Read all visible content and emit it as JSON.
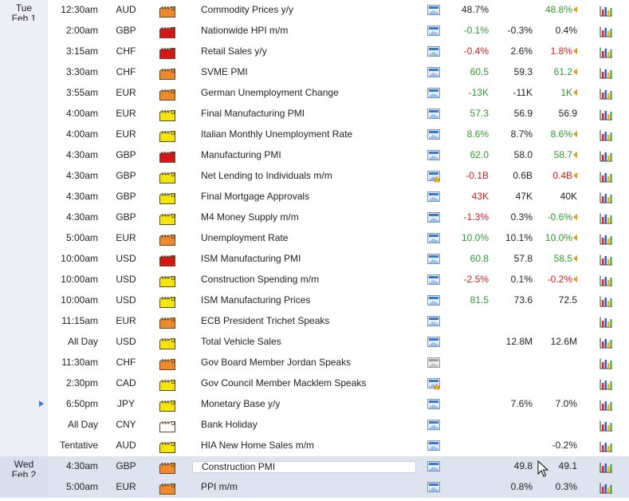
{
  "days": [
    {
      "line1": "Tue",
      "line2": "Feb 1"
    },
    {
      "line1": "Wed",
      "line2": "Feb 2"
    }
  ],
  "impact_colors": {
    "high": "#d81616",
    "medium": "#f0882c",
    "low": "#f5e60a",
    "none": "#ffffff"
  },
  "events": [
    {
      "day": 0,
      "time": "12:30am",
      "currency": "AUD",
      "impact": "medium",
      "name": "Commodity Prices y/y",
      "detail_icon": "detail-icon",
      "actual": "48.7%",
      "actual_class": "neutral",
      "forecast": "",
      "previous": "48.8%",
      "previous_class": "pos",
      "revised": true
    },
    {
      "day": 0,
      "time": "2:00am",
      "currency": "GBP",
      "impact": "high",
      "name": "Nationwide HPI m/m",
      "detail_icon": "detail-icon",
      "actual": "-0.1%",
      "actual_class": "pos",
      "forecast": "-0.3%",
      "previous": "0.4%",
      "previous_class": "neutral",
      "revised": false
    },
    {
      "day": 0,
      "time": "3:15am",
      "currency": "CHF",
      "impact": "high",
      "name": "Retail Sales y/y",
      "detail_icon": "detail-icon",
      "actual": "-0.4%",
      "actual_class": "neg",
      "forecast": "2.6%",
      "previous": "1.8%",
      "previous_class": "neg",
      "revised": true
    },
    {
      "day": 0,
      "time": "3:30am",
      "currency": "CHF",
      "impact": "medium",
      "name": "SVME PMI",
      "detail_icon": "detail-icon",
      "actual": "60.5",
      "actual_class": "pos",
      "forecast": "59.3",
      "previous": "61.2",
      "previous_class": "pos",
      "revised": true
    },
    {
      "day": 0,
      "time": "3:55am",
      "currency": "EUR",
      "impact": "medium",
      "name": "German Unemployment Change",
      "detail_icon": "detail-icon",
      "actual": "-13K",
      "actual_class": "pos",
      "forecast": "-11K",
      "previous": "1K",
      "previous_class": "pos",
      "revised": true
    },
    {
      "day": 0,
      "time": "4:00am",
      "currency": "EUR",
      "impact": "low",
      "name": "Final Manufacturing PMI",
      "detail_icon": "detail-icon",
      "actual": "57.3",
      "actual_class": "pos",
      "forecast": "56.9",
      "previous": "56.9",
      "previous_class": "neutral",
      "revised": false
    },
    {
      "day": 0,
      "time": "4:00am",
      "currency": "EUR",
      "impact": "low",
      "name": "Italian Monthly Unemployment Rate",
      "detail_icon": "detail-icon",
      "actual": "8.6%",
      "actual_class": "pos",
      "forecast": "8.7%",
      "previous": "8.6%",
      "previous_class": "pos",
      "revised": true
    },
    {
      "day": 0,
      "time": "4:30am",
      "currency": "GBP",
      "impact": "high",
      "name": "Manufacturing PMI",
      "detail_icon": "detail-icon",
      "actual": "62.0",
      "actual_class": "pos",
      "forecast": "58.0",
      "previous": "58.7",
      "previous_class": "pos",
      "revised": true
    },
    {
      "day": 0,
      "time": "4:30am",
      "currency": "GBP",
      "impact": "low",
      "name": "Net Lending to Individuals m/m",
      "detail_icon": "detail-star-icon",
      "actual": "-0.1B",
      "actual_class": "neg",
      "forecast": "0.6B",
      "previous": "0.4B",
      "previous_class": "neg",
      "revised": true
    },
    {
      "day": 0,
      "time": "4:30am",
      "currency": "GBP",
      "impact": "low",
      "name": "Final Mortgage Approvals",
      "detail_icon": "detail-icon",
      "actual": "43K",
      "actual_class": "neg",
      "forecast": "47K",
      "previous": "40K",
      "previous_class": "neutral",
      "revised": false
    },
    {
      "day": 0,
      "time": "4:30am",
      "currency": "GBP",
      "impact": "low",
      "name": "M4 Money Supply m/m",
      "detail_icon": "detail-icon",
      "actual": "-1.3%",
      "actual_class": "neg",
      "forecast": "0.3%",
      "previous": "-0.6%",
      "previous_class": "pos",
      "revised": true
    },
    {
      "day": 0,
      "time": "5:00am",
      "currency": "EUR",
      "impact": "medium",
      "name": "Unemployment Rate",
      "detail_icon": "detail-icon",
      "actual": "10.0%",
      "actual_class": "pos",
      "forecast": "10.1%",
      "previous": "10.0%",
      "previous_class": "pos",
      "revised": true
    },
    {
      "day": 0,
      "time": "10:00am",
      "currency": "USD",
      "impact": "high",
      "name": "ISM Manufacturing PMI",
      "detail_icon": "detail-icon",
      "actual": "60.8",
      "actual_class": "pos",
      "forecast": "57.8",
      "previous": "58.5",
      "previous_class": "pos",
      "revised": true
    },
    {
      "day": 0,
      "time": "10:00am",
      "currency": "USD",
      "impact": "low",
      "name": "Construction Spending m/m",
      "detail_icon": "detail-icon",
      "actual": "-2.5%",
      "actual_class": "neg",
      "forecast": "0.1%",
      "previous": "-0.2%",
      "previous_class": "neg",
      "revised": true
    },
    {
      "day": 0,
      "time": "10:00am",
      "currency": "USD",
      "impact": "low",
      "name": "ISM Manufacturing Prices",
      "detail_icon": "detail-icon",
      "actual": "81.5",
      "actual_class": "pos",
      "forecast": "73.6",
      "previous": "72.5",
      "previous_class": "neutral",
      "revised": false
    },
    {
      "day": 0,
      "time": "11:15am",
      "currency": "EUR",
      "impact": "medium",
      "name": "ECB President Trichet Speaks",
      "detail_icon": "detail-icon",
      "actual": "",
      "actual_class": "neutral",
      "forecast": "",
      "previous": "",
      "previous_class": "neutral",
      "revised": false
    },
    {
      "day": 0,
      "time": "All Day",
      "currency": "USD",
      "impact": "low",
      "name": "Total Vehicle Sales",
      "detail_icon": "detail-icon",
      "actual": "",
      "actual_class": "neutral",
      "forecast": "12.8M",
      "previous": "12.6M",
      "previous_class": "neutral",
      "revised": false
    },
    {
      "day": 0,
      "time": "11:30am",
      "currency": "CHF",
      "impact": "medium",
      "name": "Gov Board Member Jordan Speaks",
      "detail_icon": "detail-gray-icon",
      "actual": "",
      "actual_class": "neutral",
      "forecast": "",
      "previous": "",
      "previous_class": "neutral",
      "revised": false
    },
    {
      "day": 0,
      "time": "2:30pm",
      "currency": "CAD",
      "impact": "low",
      "name": "Gov Council Member Macklem Speaks",
      "detail_icon": "detail-star-icon",
      "actual": "",
      "actual_class": "neutral",
      "forecast": "",
      "previous": "",
      "previous_class": "neutral",
      "revised": false
    },
    {
      "day": 0,
      "time": "6:50pm",
      "currency": "JPY",
      "impact": "low",
      "name": "Monetary Base y/y",
      "detail_icon": "detail-icon",
      "actual": "",
      "actual_class": "neutral",
      "forecast": "7.6%",
      "previous": "7.0%",
      "previous_class": "neutral",
      "revised": false,
      "next_up": true
    },
    {
      "day": 0,
      "time": "All Day",
      "currency": "CNY",
      "impact": "none",
      "name": "Bank Holiday",
      "detail_icon": "detail-icon",
      "actual": "",
      "actual_class": "neutral",
      "forecast": "",
      "previous": "",
      "previous_class": "neutral",
      "revised": false
    },
    {
      "day": 0,
      "time": "Tentative",
      "currency": "AUD",
      "impact": "low",
      "name": "HIA New Home Sales m/m",
      "detail_icon": "detail-icon",
      "actual": "",
      "actual_class": "neutral",
      "forecast": "",
      "previous": "-0.2%",
      "previous_class": "neutral",
      "revised": false
    },
    {
      "day": 1,
      "time": "4:30am",
      "currency": "GBP",
      "impact": "medium",
      "name": "Construction PMI",
      "detail_icon": "detail-icon",
      "actual": "",
      "actual_class": "neutral",
      "forecast": "49.8",
      "previous": "49.1",
      "previous_class": "neutral",
      "revised": false,
      "highlight": true
    },
    {
      "day": 1,
      "time": "5:00am",
      "currency": "EUR",
      "impact": "medium",
      "name": "PPI m/m",
      "detail_icon": "detail-icon",
      "actual": "",
      "actual_class": "neutral",
      "forecast": "0.8%",
      "previous": "0.3%",
      "previous_class": "neutral",
      "revised": false
    }
  ]
}
